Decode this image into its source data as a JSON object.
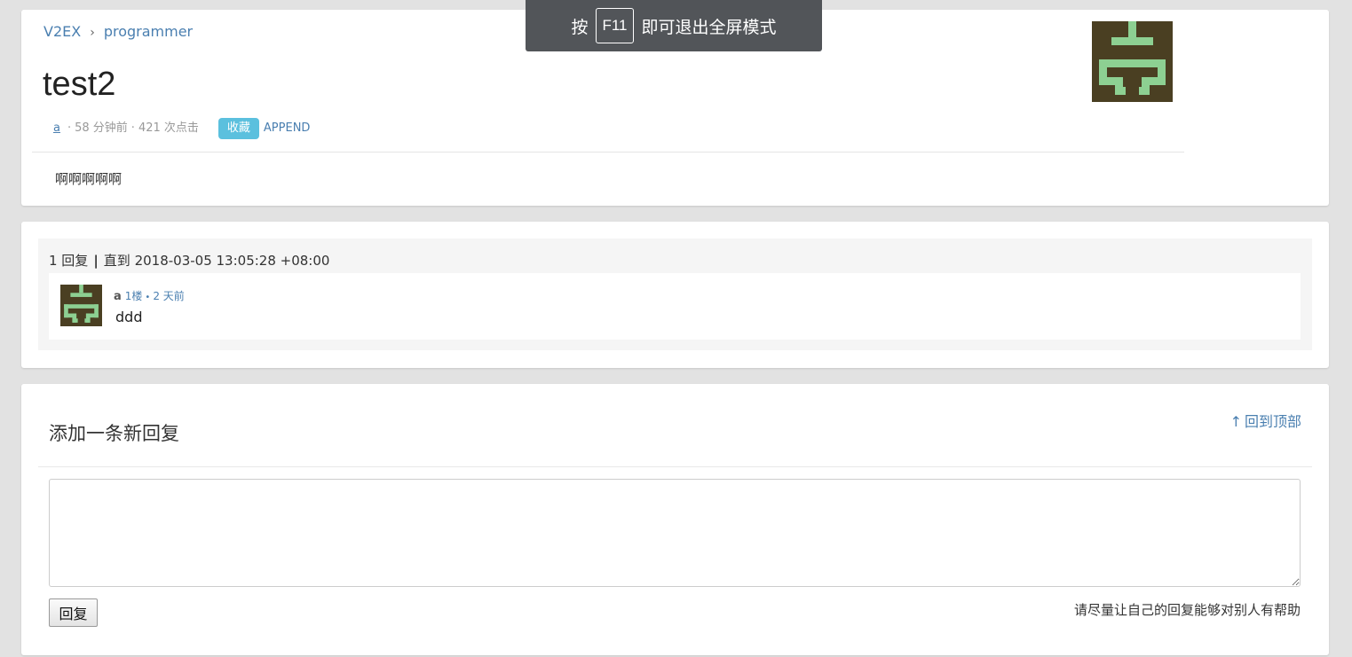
{
  "breadcrumb": {
    "home": "V2EX",
    "separator": "›",
    "node": "programmer"
  },
  "topic": {
    "title": "test2",
    "author": "a",
    "time": "58 分钟前",
    "clicks": "421 次点击",
    "meta_separator": "·",
    "favorite_label": "收藏",
    "append_label": "APPEND",
    "content": "啊啊啊啊啊"
  },
  "replies": {
    "count_text": "1 回复",
    "divider": "|",
    "until_text": "直到 2018-03-05 13:05:28 +08:00",
    "items": [
      {
        "author": "a",
        "floor": "1楼",
        "bullet": "•",
        "time": "2 天前",
        "body": "ddd"
      }
    ]
  },
  "new_reply": {
    "title": "添加一条新回复",
    "back_to_top": "回到顶部",
    "back_to_top_icon": "↑",
    "textarea_value": "",
    "submit_label": "回复",
    "hint": "请尽量让自己的回复能够对别人有帮助"
  },
  "fullscreen_notice": {
    "prefix": "按",
    "key": "F11",
    "suffix": "即可退出全屏模式"
  },
  "colors": {
    "page_bg": "#e2e2e2",
    "link": "#4a7fb0",
    "favorite_button": "#5bc0de",
    "avatar_bg": "#4a3f22",
    "avatar_fg": "#8dd092"
  },
  "icons": {
    "avatar": "identicon-avatar",
    "breadcrumb_separator": "chevron-right-icon",
    "back_to_top": "arrow-up-icon"
  }
}
